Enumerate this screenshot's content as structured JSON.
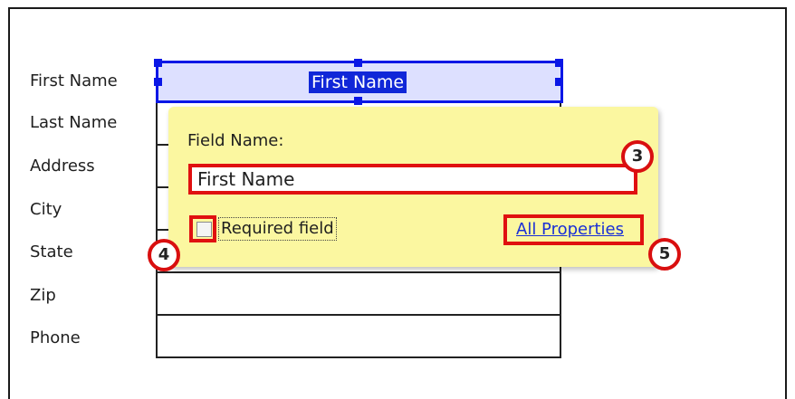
{
  "form": {
    "labels": [
      "First Name",
      "Last Name",
      "Address",
      "City",
      "State",
      "Zip",
      "Phone"
    ]
  },
  "selected_field": {
    "text": "First Name"
  },
  "popup": {
    "field_name_label": "Field Name:",
    "field_name_value": "First Name",
    "required_label": "Required field",
    "required_checked": false,
    "all_properties_link": "All Properties"
  },
  "callouts": {
    "c3": "3",
    "c4": "4",
    "c5": "5"
  },
  "colors": {
    "selection_blue": "#0a17e6",
    "popup_yellow": "#fbf7a0",
    "callout_red": "#e01010"
  }
}
